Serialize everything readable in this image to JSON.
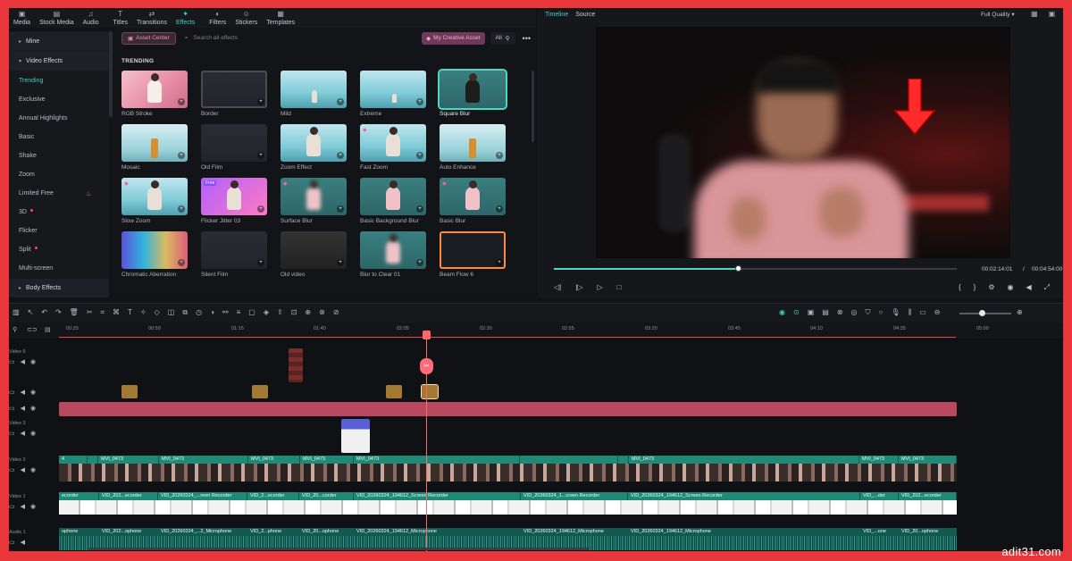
{
  "topbar": {
    "tabs": [
      {
        "label": "Media",
        "icon": "media-icon"
      },
      {
        "label": "Stock Media",
        "icon": "stock-icon"
      },
      {
        "label": "Audio",
        "icon": "audio-icon"
      },
      {
        "label": "Titles",
        "icon": "titles-icon"
      },
      {
        "label": "Transitions",
        "icon": "transitions-icon"
      },
      {
        "label": "Effects",
        "icon": "effects-icon",
        "active": true
      },
      {
        "label": "Filters",
        "icon": "filters-icon"
      },
      {
        "label": "Stickers",
        "icon": "stickers-icon"
      },
      {
        "label": "Templates",
        "icon": "templates-icon"
      }
    ]
  },
  "sidebar": {
    "items": [
      {
        "label": "Mine",
        "type": "head"
      },
      {
        "label": "Video Effects",
        "type": "head"
      },
      {
        "label": "Trending",
        "active": true
      },
      {
        "label": "Exclusive"
      },
      {
        "label": "Annual Highlights"
      },
      {
        "label": "Basic"
      },
      {
        "label": "Shake"
      },
      {
        "label": "Zoom"
      },
      {
        "label": "Limited Free",
        "fire": true
      },
      {
        "label": "3D",
        "dot": true
      },
      {
        "label": "Flicker"
      },
      {
        "label": "Split",
        "dot": true
      },
      {
        "label": "Multi-screen"
      },
      {
        "label": "Body Effects",
        "type": "head"
      }
    ]
  },
  "effects": {
    "asset_center": "Asset Center",
    "search_placeholder": "Search all effects",
    "creative_assets": "My Creative Asset",
    "all_label": "All",
    "more_label": "•••",
    "section": "TRENDING",
    "items": [
      {
        "label": "RGB Stroke"
      },
      {
        "label": "Border"
      },
      {
        "label": "Mild"
      },
      {
        "label": "Extreme"
      },
      {
        "label": "Square Blur",
        "selected": true
      },
      {
        "label": "Mosaic"
      },
      {
        "label": "Old Film"
      },
      {
        "label": "Zoom Effect"
      },
      {
        "label": "Fast Zoom"
      },
      {
        "label": "Auto Enhance"
      },
      {
        "label": "Slow Zoom"
      },
      {
        "label": "Flicker Jitter 03"
      },
      {
        "label": "Surface Blur"
      },
      {
        "label": "Basic Background Blur"
      },
      {
        "label": "Basic Blur"
      },
      {
        "label": "Chromatic Aberration"
      },
      {
        "label": "Silent Film"
      },
      {
        "label": "Old video"
      },
      {
        "label": "Blur to Clear 01"
      },
      {
        "label": "Beam Flow 6"
      }
    ],
    "free_badge": "Free"
  },
  "preview": {
    "tab_timeline": "Timeline",
    "tab_source": "Source",
    "quality": "Full Quality",
    "current_time": "00:02:14:01",
    "separator": "/",
    "total_time": "00:04:54:00",
    "progress_fraction": 0.456
  },
  "timeline": {
    "ruler": [
      "00:25",
      "00:50",
      "01:15",
      "01:40",
      "02:05",
      "02:30",
      "02:55",
      "03:20",
      "03:45",
      "04:10",
      "04:35",
      "05:00"
    ],
    "tracks": {
      "video6": "Video 6",
      "video3": "Video 3",
      "video2": "Video 2",
      "video1": "Video 1",
      "audio1": "Audio 1"
    },
    "clip_mvi": "MVI_0473",
    "clip_mvi_short": "MVI_0473",
    "clips_v1": [
      "ecorder",
      "VID_202...ecorder",
      "VID_20260324_...reen Recorder",
      "VID_2...ecorder",
      "VID_20...corder",
      "VID_20260324_194612_Screen Recorder",
      "VID_20260324_1...creen Recorder",
      "VID_20260324_194612_Screen Recorder",
      "VID_...der",
      "VID_202...ecorder"
    ],
    "clips_a1": [
      "ophone",
      "VID_202...ophone",
      "VID_20260324_...2_Microphone",
      "VID_2...phone",
      "VID_20...ophone",
      "VID_20260324_194612_Microphone",
      "VID_20260324_194612_Microphone",
      "VID_20260324_194612_Microphone",
      "VID_...one",
      "VID_20...ophone"
    ],
    "clips_v2": [
      "4",
      "MVI_0473",
      "MVI_0473",
      "MVI_0473",
      "MVI_0473",
      "MVI_0473",
      "MVI_0473",
      "MVI_0473",
      "MVI_0473",
      "MVI_0473"
    ],
    "clip_v2_tail": [
      "MVI_0473",
      "MVI_0473"
    ]
  },
  "watermark": "adit31.com",
  "colors": {
    "accent": "#3fd1bd",
    "frame": "#e8363b",
    "pink_track": "#b8485f"
  }
}
